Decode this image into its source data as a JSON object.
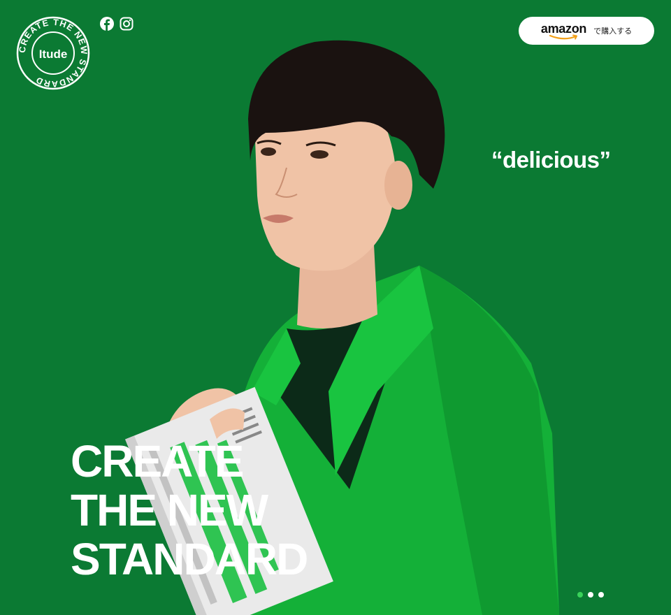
{
  "brand": {
    "logo_text": "Itude",
    "seal_text": "CREATE THE NEW STANDARD ",
    "colors": {
      "background": "#0b7a33",
      "jacket": "#16b93a",
      "accent": "#3ad25a"
    }
  },
  "social": {
    "icons": [
      "facebook-icon",
      "instagram-icon"
    ]
  },
  "amazon": {
    "logo_text": "amazon",
    "buy_label": "で購入する"
  },
  "hero": {
    "quote": "“delicious”",
    "headline": [
      "CREATE",
      "THE NEW",
      "STANDARD"
    ]
  },
  "slider": {
    "dots": 3,
    "active_index": 0
  }
}
